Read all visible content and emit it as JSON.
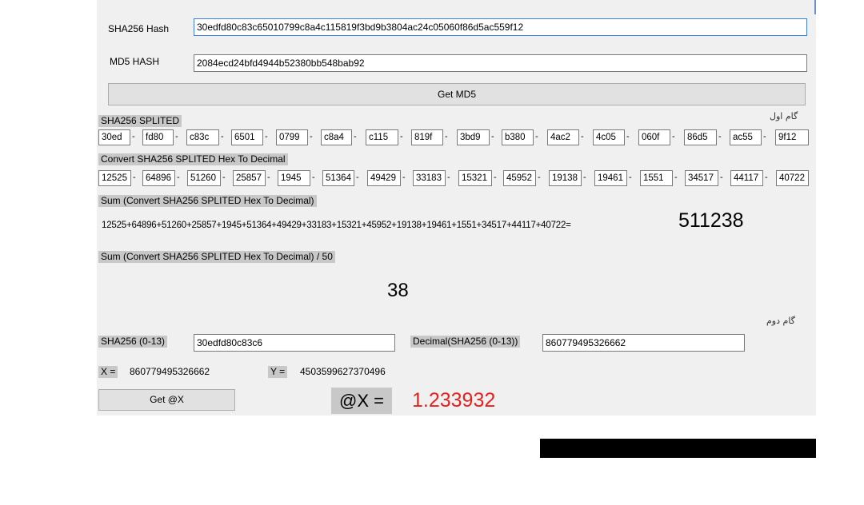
{
  "hash_section": {
    "sha256_label": "SHA256 Hash",
    "sha256_value": "30edfd80c83c65010799c8a4c115819f3bd9b3804ac24c05060f86d5ac559f12",
    "md5_label": "MD5 HASH",
    "md5_value": "2084ecd24bfd4944b52380bb548bab92",
    "get_md5_button": "Get MD5"
  },
  "step_one_label": "گام اول",
  "split_section": {
    "label": "SHA256 SPLITED",
    "parts": [
      "30ed",
      "fd80",
      "c83c",
      "6501",
      "0799",
      "c8a4",
      "c115",
      "819f",
      "3bd9",
      "b380",
      "4ac2",
      "4c05",
      "060f",
      "86d5",
      "ac55",
      "9f12"
    ],
    "separator": "-"
  },
  "decimal_section": {
    "label": "Convert SHA256 SPLITED Hex To Decimal",
    "values": [
      "12525",
      "64896",
      "51260",
      "25857",
      "1945",
      "51364",
      "49429",
      "33183",
      "15321",
      "45952",
      "19138",
      "19461",
      "1551",
      "34517",
      "44117",
      "40722"
    ]
  },
  "sum_section": {
    "label": "Sum (Convert SHA256 SPLITED Hex To Decimal)",
    "expression": "12525+64896+51260+25857+1945+51364+49429+33183+15321+45952+19138+19461+1551+34517+44117+40722=",
    "result": "511238"
  },
  "div_section": {
    "label": "Sum (Convert SHA256 SPLITED Hex To Decimal) / 50",
    "result": "38"
  },
  "step_two_label": "گام دوم",
  "step_two": {
    "sha_label": "SHA256 (0-13)",
    "sha_value": "30edfd80c83c6",
    "dec_label": "Decimal(SHA256 (0-13))",
    "dec_value": "860779495326662",
    "x_label": "X =",
    "x_value": "860779495326662",
    "y_label": "Y =",
    "y_value": "4503599627370496",
    "get_x_button": "Get @X",
    "at_x_label": "@X =",
    "at_x_value": "1.233932"
  },
  "colors": {
    "panel_bg": "#f0f0f0",
    "result_red": "#e8201e",
    "label_gray_bg": "#c8c8c8",
    "redaction": "#000000"
  }
}
